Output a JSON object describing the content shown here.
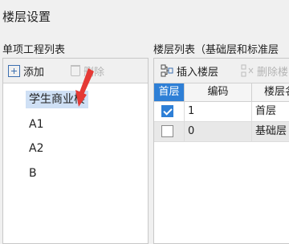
{
  "window": {
    "title": "楼层设置"
  },
  "left_panel": {
    "label": "单项工程列表",
    "toolbar": {
      "add_label": "添加",
      "delete_label": "删除"
    },
    "items": [
      {
        "label": "学生商业楼",
        "selected": true
      },
      {
        "label": "A1",
        "selected": false
      },
      {
        "label": "A2",
        "selected": false
      },
      {
        "label": "B",
        "selected": false
      }
    ]
  },
  "right_panel": {
    "label": "楼层列表（基础层和标准层",
    "toolbar": {
      "insert_label": "插入楼层",
      "delete_label": "删除楼"
    },
    "columns": [
      "首层",
      "编码",
      "楼层名"
    ],
    "rows": [
      {
        "first_floor": true,
        "code": "1",
        "name": "首层"
      },
      {
        "first_floor": false,
        "code": "0",
        "name": "基础层"
      }
    ]
  },
  "colors": {
    "accent": "#2e7fd6",
    "selection": "#cfe0f5",
    "pointer": "#e53935"
  }
}
